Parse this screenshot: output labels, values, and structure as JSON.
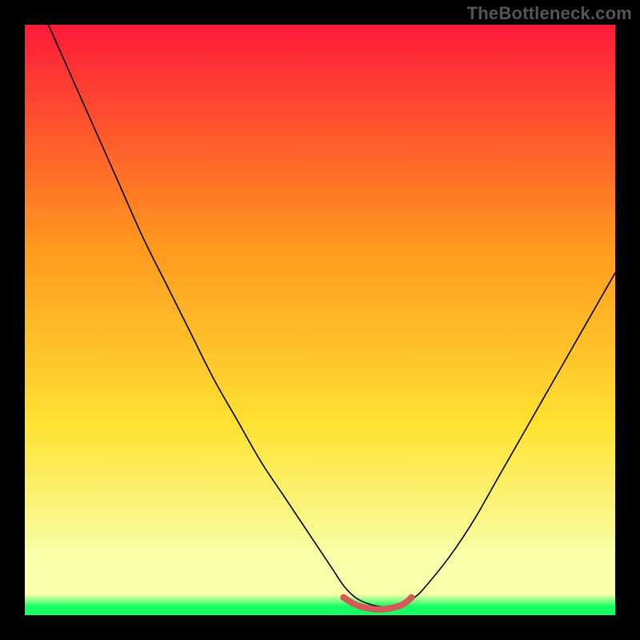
{
  "watermark": "TheBottleneck.com",
  "chart_data": {
    "type": "line",
    "title": "",
    "xlabel": "",
    "ylabel": "",
    "xlim": [
      0,
      100
    ],
    "ylim": [
      0,
      100
    ],
    "grid": false,
    "legend": false,
    "background_gradient": {
      "top_color": "#ff1a3a",
      "mid_upper_color": "#ff9a1e",
      "mid_lower_color": "#ffe233",
      "lower_band_color": "#f7ffa8",
      "bottom_color": "#17ff64"
    },
    "series": [
      {
        "name": "curve",
        "color": "#000000",
        "stroke_width": 1.6,
        "x": [
          4,
          8,
          12,
          16,
          20,
          24,
          28,
          32,
          36,
          40,
          44,
          48,
          52,
          54,
          56,
          58,
          60,
          62,
          64,
          66,
          68,
          72,
          76,
          80,
          84,
          88,
          92,
          96,
          100
        ],
        "y": [
          100,
          91,
          82,
          73,
          64,
          56,
          48,
          40,
          33,
          26,
          20,
          14,
          8,
          5,
          3,
          2,
          1.5,
          1.5,
          2,
          3,
          5,
          10,
          16,
          23,
          30,
          37,
          44,
          51,
          58
        ]
      },
      {
        "name": "bottom-marker",
        "color": "#d45a5a",
        "stroke_width": 8,
        "x": [
          54,
          56,
          58,
          60,
          62,
          64,
          65.5
        ],
        "y": [
          3.0,
          1.8,
          1.2,
          1.0,
          1.2,
          1.8,
          3.0
        ]
      }
    ],
    "markers": [
      {
        "name": "marker-left-end",
        "x": 54,
        "y": 3.0,
        "r": 4.2,
        "color": "#d45a5a"
      },
      {
        "name": "marker-right-end",
        "x": 65.5,
        "y": 3.0,
        "r": 4.2,
        "color": "#d45a5a"
      }
    ]
  }
}
